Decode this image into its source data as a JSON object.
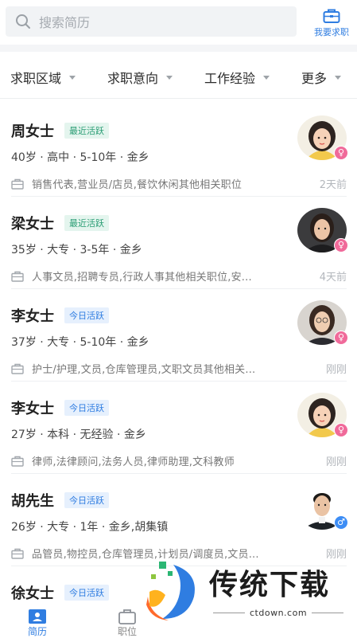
{
  "search": {
    "placeholder": "搜索简历"
  },
  "job_request_button": {
    "label": "我要求职"
  },
  "filters": [
    "求职区域",
    "求职意向",
    "工作经验",
    "更多"
  ],
  "candidates": [
    {
      "name": "周女士",
      "status": "最近活跃",
      "status_color": "green",
      "details": "40岁 · 高中 · 5-10年 · 金乡",
      "jobs": "销售代表,营业员/店员,餐饮休闲其他相关职位",
      "time": "2天前",
      "gender": "female"
    },
    {
      "name": "梁女士",
      "status": "最近活跃",
      "status_color": "green",
      "details": "35岁 · 大专 · 3-5年 · 金乡",
      "jobs": "人事文员,招聘专员,行政人事其他相关职位,安...",
      "time": "4天前",
      "gender": "female"
    },
    {
      "name": "李女士",
      "status": "今日活跃",
      "status_color": "blue",
      "details": "37岁 · 大专 · 5-10年 · 金乡",
      "jobs": "护士/护理,文员,仓库管理员,文职文员其他相关...",
      "time": "刚刚",
      "gender": "female"
    },
    {
      "name": "李女士",
      "status": "今日活跃",
      "status_color": "blue",
      "details": "27岁 · 本科 · 无经验 · 金乡",
      "jobs": "律师,法律顾问,法务人员,律师助理,文科教师",
      "time": "刚刚",
      "gender": "female"
    },
    {
      "name": "胡先生",
      "status": "今日活跃",
      "status_color": "blue",
      "details": "26岁 · 大专 · 1年 · 金乡,胡集镇",
      "jobs": "品管员,物控员,仓库管理员,计划员/调度员,文员...",
      "time": "刚刚",
      "gender": "male"
    },
    {
      "name": "徐女士",
      "status": "今日活跃",
      "status_color": "blue",
      "details": "",
      "jobs": "",
      "time": "",
      "gender": "female"
    }
  ],
  "bottom_nav": [
    {
      "label": "简历",
      "active": true
    },
    {
      "label": "职位",
      "active": false
    }
  ],
  "watermark": {
    "title": "传统下载",
    "url": "ctdown.com"
  },
  "colors": {
    "accent": "#2f7de1",
    "active_green": "#2a9d74",
    "female": "#f06a9a",
    "male": "#3d8df5"
  }
}
